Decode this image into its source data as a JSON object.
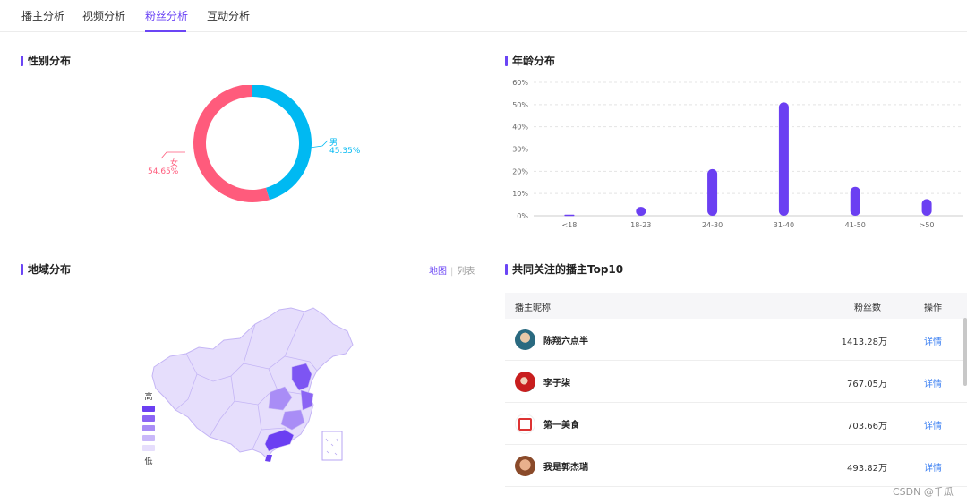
{
  "tabs": [
    {
      "label": "播主分析"
    },
    {
      "label": "视频分析"
    },
    {
      "label": "粉丝分析",
      "active": true
    },
    {
      "label": "互动分析"
    }
  ],
  "gender": {
    "title": "性别分布",
    "female_label": "女",
    "female_value": "54.65%",
    "male_label": "男",
    "male_value": "45.35%",
    "female_fraction": 0.5465,
    "female_color": "#ff5b7c",
    "male_color": "#00b9f2"
  },
  "age": {
    "title": "年龄分布"
  },
  "chart_data": {
    "type": "bar",
    "categories": [
      "<18",
      "18-23",
      "24-30",
      "31-40",
      "41-50",
      ">50"
    ],
    "values": [
      0.5,
      4,
      21,
      51,
      13,
      7.5
    ],
    "ylim": [
      0,
      60
    ],
    "yticks": [
      "0%",
      "10%",
      "20%",
      "30%",
      "40%",
      "50%",
      "60%"
    ],
    "grid": true,
    "color": "#6b3ff2"
  },
  "region": {
    "title": "地域分布",
    "view_map": "地图",
    "view_list": "列表",
    "legend_high": "高",
    "legend_low": "低",
    "legend_colors": [
      "#6b3ff2",
      "#8b64f4",
      "#a98df6",
      "#c9b8f9",
      "#e6defc"
    ]
  },
  "top10": {
    "title": "共同关注的播主Top10",
    "col_name": "播主昵称",
    "col_fans": "粉丝数",
    "col_action": "操作",
    "rows": [
      {
        "name": "陈翔六点半",
        "fans": "1413.28万",
        "action": "详情"
      },
      {
        "name": "李子柒",
        "fans": "767.05万",
        "action": "详情"
      },
      {
        "name": "第一美食",
        "fans": "703.66万",
        "action": "详情"
      },
      {
        "name": "我是郭杰瑞",
        "fans": "493.82万",
        "action": "详情"
      }
    ]
  },
  "watermark": "CSDN @千瓜"
}
